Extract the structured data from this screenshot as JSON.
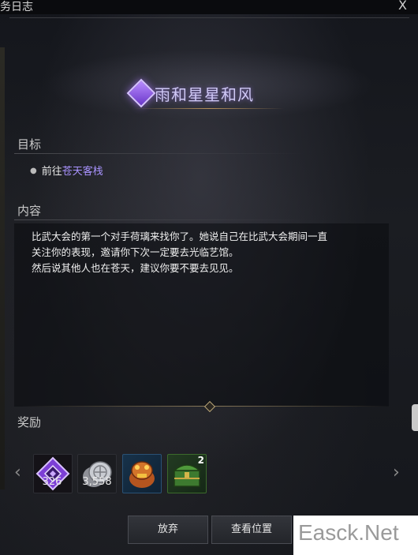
{
  "window": {
    "title": "务日志",
    "close": "X"
  },
  "quest": {
    "title": "雨和星星和风"
  },
  "objective": {
    "label": "目标",
    "prefix": "前往",
    "place": "苍天客栈"
  },
  "content": {
    "label": "内容",
    "lines": [
      "比武大会的第一个对手荷璃来找你了。她说自己在比武大会期间一直",
      "关注你的表现，邀请你下次一定要去光临艺馆。",
      "然后说其他人也在苍天，建议你要不要去见见。"
    ]
  },
  "rewards": {
    "label": "奖励",
    "items": [
      {
        "icon": "purple-diamond-icon",
        "count": "326"
      },
      {
        "icon": "silver-coin-icon",
        "count": "3,558"
      },
      {
        "icon": "toad-treasure-icon",
        "count": ""
      },
      {
        "icon": "green-chest-icon",
        "count": "",
        "badge": "2"
      }
    ]
  },
  "buttons": {
    "abandon": "放弃",
    "view_location": "查看位置"
  },
  "watermark": "Easck.Net",
  "colors": {
    "accent": "#a993ff",
    "gold": "#b48e5a"
  }
}
